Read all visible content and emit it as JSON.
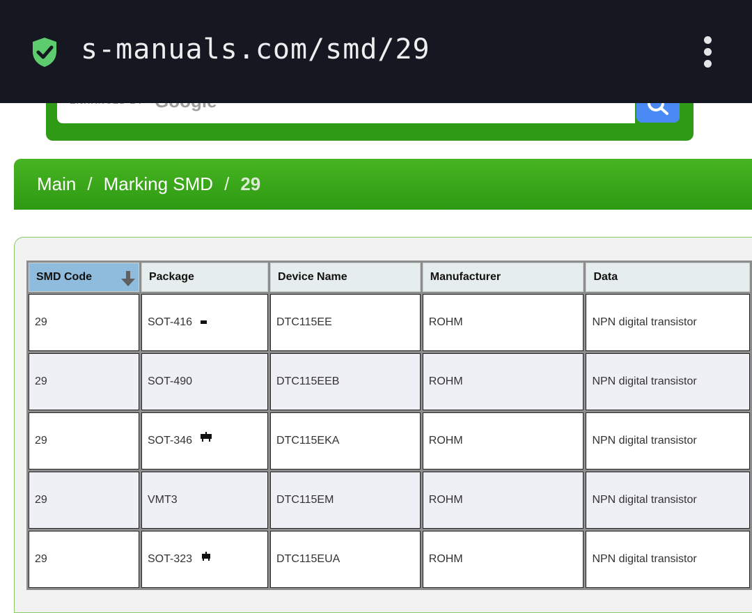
{
  "browser": {
    "url": "s-manuals.com/smd/29",
    "icons": {
      "security": "shield-check-icon",
      "menu": "more-vertical-icon"
    },
    "colors": {
      "bar": "#151820",
      "shield": "#5ccc6e"
    }
  },
  "search": {
    "enhanced_label": "ENHANCED BY",
    "google_label": "Google",
    "button_icon": "search-icon",
    "colors": {
      "frame": "#2f9a16",
      "button": "#4a8af4"
    }
  },
  "breadcrumb": {
    "items": [
      "Main",
      "Marking SMD"
    ],
    "separator": "/",
    "current": "29",
    "colors": {
      "bar": "#38a81a"
    }
  },
  "table": {
    "headers": [
      "SMD Code",
      "Package",
      "Device Name",
      "Manufacturer",
      "Data"
    ],
    "sorted_column": "SMD Code",
    "sort_icon": "sort-arrow-down-icon",
    "rows": [
      {
        "code": "29",
        "package": "SOT-416",
        "package_icon": "package-sot-icon",
        "device": "DTC115EE",
        "manufacturer": "ROHM",
        "data": "NPN digital transistor"
      },
      {
        "code": "29",
        "package": "SOT-490",
        "package_icon": "",
        "device": "DTC115EEB",
        "manufacturer": "ROHM",
        "data": "NPN digital transistor"
      },
      {
        "code": "29",
        "package": "SOT-346",
        "package_icon": "package-sot-icon",
        "device": "DTC115EKA",
        "manufacturer": "ROHM",
        "data": "NPN digital transistor"
      },
      {
        "code": "29",
        "package": "VMT3",
        "package_icon": "",
        "device": "DTC115EM",
        "manufacturer": "ROHM",
        "data": "NPN digital transistor"
      },
      {
        "code": "29",
        "package": "SOT-323",
        "package_icon": "package-sot-icon",
        "device": "DTC115EUA",
        "manufacturer": "ROHM",
        "data": "NPN digital transistor"
      }
    ]
  }
}
